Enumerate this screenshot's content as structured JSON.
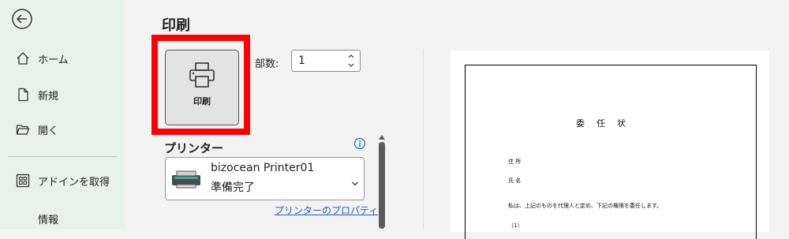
{
  "sidebar": {
    "items": [
      {
        "label": "ホーム",
        "icon": "home-icon"
      },
      {
        "label": "新規",
        "icon": "new-document-icon"
      },
      {
        "label": "開く",
        "icon": "folder-open-icon"
      },
      {
        "label": "アドインを取得",
        "icon": "addins-grid-icon"
      },
      {
        "label": "情報",
        "icon": ""
      }
    ]
  },
  "main": {
    "title": "印刷",
    "print_button_label": "印刷",
    "copies_label": "部数:",
    "copies_value": "1",
    "printer_heading": "プリンター",
    "printer_name": "bizocean Printer01",
    "printer_status": "準備完了",
    "printer_properties_link": "プリンターのプロパティ"
  },
  "preview": {
    "title": "委　任　状",
    "line1": "住 所",
    "line2": "氏 名",
    "line3": "私は、上記のものを代理人と定め、下記の権限を委任します。",
    "line4": "（1）"
  },
  "colors": {
    "sidebar_bg": "#e6f2ea",
    "highlight": "#ff0000",
    "link": "#1f5fbf"
  }
}
